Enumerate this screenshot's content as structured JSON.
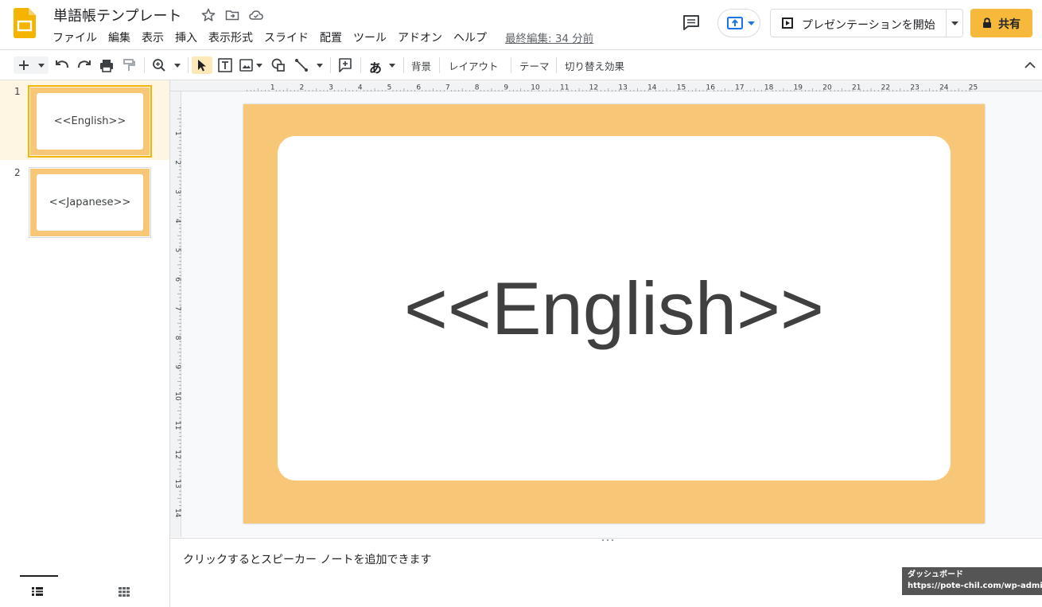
{
  "header": {
    "title": "単語帳テンプレート",
    "last_edit": "最終編集: 34 分前",
    "menu": [
      "ファイル",
      "編集",
      "表示",
      "挿入",
      "表示形式",
      "スライド",
      "配置",
      "ツール",
      "アドオン",
      "ヘルプ"
    ],
    "present_label": "プレゼンテーションを開始",
    "share_label": "共有",
    "brand_color": "#f4b400",
    "share_color": "#f6b93b"
  },
  "toolbar": {
    "input_tools_glyph": "あ",
    "background_label": "背景",
    "layout_label": "レイアウト",
    "theme_label": "テーマ",
    "transition_label": "切り替え効果"
  },
  "filmstrip": {
    "slides": [
      {
        "number": "1",
        "text": "<<English>>",
        "selected": true
      },
      {
        "number": "2",
        "text": "<<Japanese>>",
        "selected": false
      }
    ]
  },
  "ruler": {
    "top_ticks": [
      "1",
      "2",
      "3",
      "4",
      "5",
      "6",
      "7",
      "8",
      "9",
      "10",
      "11",
      "12",
      "13",
      "14",
      "15",
      "16",
      "17",
      "18",
      "19",
      "20",
      "21",
      "22",
      "23",
      "24",
      "25"
    ],
    "left_ticks": [
      "1",
      "2",
      "3",
      "4",
      "5",
      "6",
      "7",
      "8",
      "9",
      "10",
      "11",
      "12",
      "13",
      "14"
    ]
  },
  "slide": {
    "text": "<<English>>",
    "frame_color": "#f7c777"
  },
  "notes": {
    "placeholder": "クリックするとスピーカー ノートを追加できます"
  },
  "tooltip": {
    "line1": "ダッシュボード",
    "line2": "https://pote-chil.com/wp-admin/"
  }
}
